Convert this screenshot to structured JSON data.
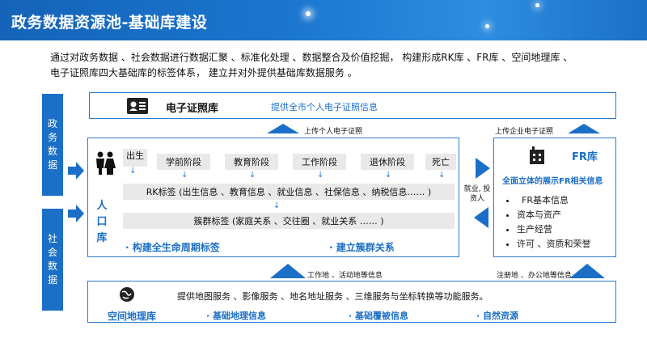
{
  "header": {
    "title": "政务数据资源池-基础库建设"
  },
  "intro": {
    "line1": "通过对政务数据 、社会数据进行数据汇聚 、标准化处理 、数据整合及价值挖掘， 构建形成RK库 、FR库 、空间地理库 、",
    "line2": "电子证照库四大基础库的标签体系， 建立并对外提供基础库数据服务 。"
  },
  "sources": {
    "gov": "政务数据",
    "social": "社会数据"
  },
  "cert": {
    "title": "电子证照库",
    "desc": "提供全市个人电子证照信息"
  },
  "uploads": {
    "personal": "上传个人电子证照",
    "enterprise": "上传企业电子证照"
  },
  "population": {
    "title": "人口库",
    "stages": [
      "出生",
      "学前阶段",
      "教育阶段",
      "工作阶段",
      "退休阶段",
      "死亡"
    ],
    "rk_label": "RK标签 (出生信息 、教育信息 、就业信息 、社保信息 、纳税信息…… )",
    "cluster_label": "簇群标签 (家庭关系 、交往圈 、就业关系 …… )",
    "lifecycle": "· 构建全生命周期标签",
    "relation": "· 建立簇群关系"
  },
  "link_label": "就业, 投资人",
  "fr": {
    "title": "FR库",
    "subtitle": "全面立体的展示FR相关信息",
    "items": [
      "FR基本信息",
      "资本与资产",
      "生产经营",
      "许可 、资质和荣誉"
    ]
  },
  "flows": {
    "work": "工作地 、活动地等信息",
    "reg": "注册地 、办公地等信息"
  },
  "geo": {
    "desc": "提供地图服务 、影像服务 、地名地址服务 、三维服务与坐标转换等功能服务。",
    "title": "空间地理库",
    "tags": [
      "· 基础地理信息",
      "· 基础覆被信息",
      "· 自然资源"
    ]
  },
  "colors": {
    "primary": "#1b6fc7",
    "header": "#1463b8",
    "bar": "#e9e9e9"
  },
  "icons": [
    "id-card-icon",
    "people-icon",
    "building-icon",
    "globe-icon"
  ]
}
